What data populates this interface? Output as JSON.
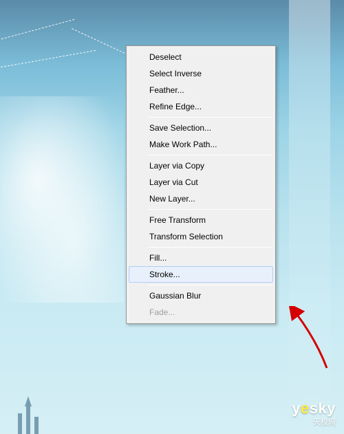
{
  "context_menu": {
    "groups": [
      [
        {
          "label": "Deselect",
          "disabled": false,
          "hover": false
        },
        {
          "label": "Select Inverse",
          "disabled": false,
          "hover": false
        },
        {
          "label": "Feather...",
          "disabled": false,
          "hover": false
        },
        {
          "label": "Refine Edge...",
          "disabled": false,
          "hover": false
        }
      ],
      [
        {
          "label": "Save Selection...",
          "disabled": false,
          "hover": false
        },
        {
          "label": "Make Work Path...",
          "disabled": false,
          "hover": false
        }
      ],
      [
        {
          "label": "Layer via Copy",
          "disabled": false,
          "hover": false
        },
        {
          "label": "Layer via Cut",
          "disabled": false,
          "hover": false
        },
        {
          "label": "New Layer...",
          "disabled": false,
          "hover": false
        }
      ],
      [
        {
          "label": "Free Transform",
          "disabled": false,
          "hover": false
        },
        {
          "label": "Transform Selection",
          "disabled": false,
          "hover": false
        }
      ],
      [
        {
          "label": "Fill...",
          "disabled": false,
          "hover": false
        },
        {
          "label": "Stroke...",
          "disabled": false,
          "hover": true
        }
      ],
      [
        {
          "label": "Gaussian Blur",
          "disabled": false,
          "hover": false
        },
        {
          "label": "Fade...",
          "disabled": true,
          "hover": false
        }
      ]
    ]
  },
  "watermark": {
    "brand_prefix": "y",
    "brand_e": "e",
    "brand_suffix": "sky",
    "subtitle": "天极网"
  },
  "annotation": {
    "arrow_color": "#d40000"
  }
}
